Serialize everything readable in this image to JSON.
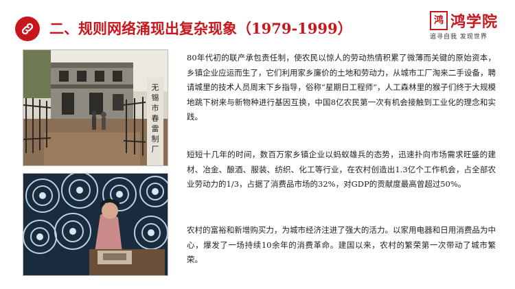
{
  "header": {
    "title": "二、规则网络涌现出复杂现象（1979-1999）",
    "icon": "link-icon",
    "accent_color": "#c8161d"
  },
  "logo": {
    "mark": "鸿",
    "name": "鸿学院",
    "tagline": "追寻自我  发现世界"
  },
  "photos": [
    {
      "icon": "factory-photo",
      "sign_text": "无锡市春雷制厂"
    },
    {
      "icon": "electric-fans-photo"
    }
  ],
  "paragraphs": [
    "80年代初的联产承包责任制，使农民以惊人的劳动热情积累了微薄而关键的原始资本，乡镇企业应运而生了，它们利用家乡廉价的土地和劳动力，从城市工厂淘来二手设备，聘请城里的技术人员周末下乡指导，俗称“星期日工程师”，人工森林里的猴子们终于大规模地跳下树来与新物种进行基因互换，中国8亿农民第一次有机会接触到工业化的理念和实践。",
    "短短十几年的时间，数百万家乡镇企业以蚂蚁雄兵的态势，迅速扑向市场需求旺盛的建材、冶金、酿酒、服装、纺织、化工等行业，在农村创造出1.3亿个工作机会，占全部农业劳动力的1/3，占据了消费品市场的32%，对GDP的贡献度最高曾超过50%。",
    "农村的富裕和新增购买力，为城市经济注进了强大的活力。以家用电器和日用消费品为中心，爆发了一场持续10余年的消费革命。建国以来，农村的繁荣第一次带动了城市繁荣。"
  ]
}
